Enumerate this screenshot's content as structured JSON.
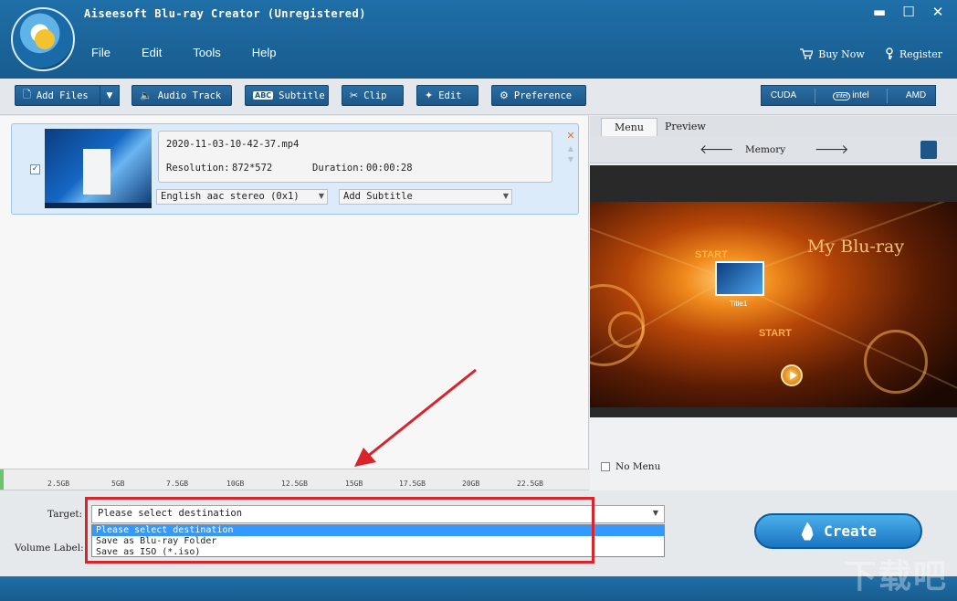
{
  "app": {
    "title": "Aiseesoft Blu-ray Creator (Unregistered)",
    "window_controls": {
      "minimize": "▬",
      "maximize": "☐",
      "close": "✕"
    }
  },
  "menu": [
    "File",
    "Edit",
    "Tools",
    "Help"
  ],
  "header_actions": {
    "buy_now": "Buy Now",
    "register": "Register"
  },
  "toolbar": {
    "add_files": "Add Files",
    "audio_track": "Audio Track",
    "subtitle": "Subtitle",
    "clip": "Clip",
    "edit": "Edit",
    "preference": "Preference",
    "subtitle_badge": "ABC",
    "accel": {
      "cuda": "CUDA",
      "intel": "intel",
      "intel_badge": "intel",
      "amd": "AMD"
    }
  },
  "file_item": {
    "name": "2020-11-03-10-42-37.mp4",
    "resolution_label": "Resolution:",
    "resolution": "872*572",
    "duration_label": "Duration:",
    "duration": "00:00:28",
    "checked_glyph": "✓",
    "audio_select": "English aac stereo (0x1)",
    "subtitle_select": "Add Subtitle"
  },
  "capacity": {
    "labels": [
      "2.5GB",
      "5GB",
      "7.5GB",
      "10GB",
      "12.5GB",
      "15GB",
      "17.5GB",
      "20GB",
      "22.5GB"
    ],
    "used_fraction": 0.006
  },
  "right_panel": {
    "tabs": [
      "Menu",
      "Preview"
    ],
    "active_tab": "Menu",
    "template_name": "Memory",
    "preview": {
      "title": "My Blu-ray",
      "start_1": "START",
      "start_2": "START",
      "title_caption": "Title1"
    },
    "no_menu": "No Menu"
  },
  "bottom": {
    "target_label": "Target:",
    "volume_label": "Volume Label:",
    "destination_value": "Please select destination",
    "options": [
      "Please select destination",
      "Save as Blu-ray Folder",
      "Save as ISO (*.iso)"
    ],
    "selected_option": "Please select destination",
    "create": "Create"
  },
  "watermark": "下载吧",
  "colors": {
    "header_blue": "#1f6fa8",
    "button_blue": "#1d5787",
    "highlight_red": "#d8242a",
    "selection_blue": "#3399ff"
  }
}
